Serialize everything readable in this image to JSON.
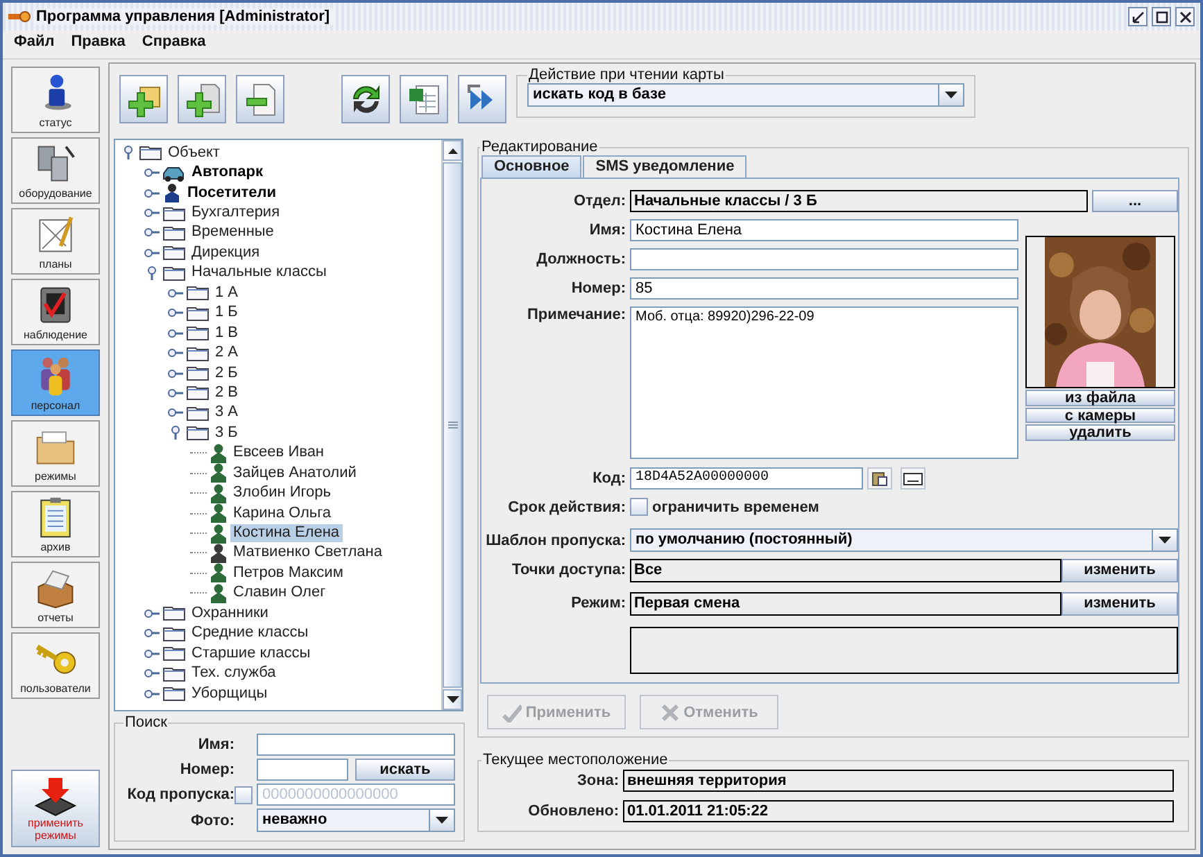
{
  "window": {
    "title": "Программа управления [Administrator]"
  },
  "menu": [
    "Файл",
    "Правка",
    "Справка"
  ],
  "sidebar": {
    "items": [
      {
        "label": "статус",
        "selected": false
      },
      {
        "label": "оборудование",
        "selected": false
      },
      {
        "label": "планы",
        "selected": false
      },
      {
        "label": "наблюдение",
        "selected": false
      },
      {
        "label": "персонал",
        "selected": true
      },
      {
        "label": "режимы",
        "selected": false
      },
      {
        "label": "архив",
        "selected": false
      },
      {
        "label": "отчеты",
        "selected": false
      },
      {
        "label": "пользователи",
        "selected": false
      }
    ],
    "apply_button": "применить режимы"
  },
  "toolbar": {
    "card_action": {
      "legend": "Действие при чтении карты",
      "value": "искать код в базе"
    }
  },
  "tree": [
    {
      "label": "Объект",
      "kind": "folder",
      "expanded": true,
      "selected": false,
      "children": [
        {
          "label": "Автопарк",
          "kind": "car",
          "expanded": false,
          "selected": false
        },
        {
          "label": "Посетители",
          "kind": "visitor",
          "expanded": false,
          "selected": false
        },
        {
          "label": "Бухгалтерия",
          "kind": "folder",
          "expanded": false,
          "selected": false
        },
        {
          "label": "Временные",
          "kind": "folder",
          "expanded": false,
          "selected": false
        },
        {
          "label": "Дирекция",
          "kind": "folder",
          "expanded": false,
          "selected": false
        },
        {
          "label": "Начальные классы",
          "kind": "folder",
          "expanded": true,
          "selected": false,
          "children": [
            {
              "label": "1 А",
              "kind": "folder",
              "expanded": false,
              "selected": false
            },
            {
              "label": "1 Б",
              "kind": "folder",
              "expanded": false,
              "selected": false
            },
            {
              "label": "1 В",
              "kind": "folder",
              "expanded": false,
              "selected": false
            },
            {
              "label": "2 А",
              "kind": "folder",
              "expanded": false,
              "selected": false
            },
            {
              "label": "2 Б",
              "kind": "folder",
              "expanded": false,
              "selected": false
            },
            {
              "label": "2 В",
              "kind": "folder",
              "expanded": false,
              "selected": false
            },
            {
              "label": "3 А",
              "kind": "folder",
              "expanded": false,
              "selected": false
            },
            {
              "label": "3 Б",
              "kind": "folder",
              "expanded": true,
              "selected": false,
              "children": [
                {
                  "label": "Евсеев Иван",
                  "kind": "person",
                  "color": "#2e6b3a",
                  "selected": false
                },
                {
                  "label": "Зайцев Анатолий",
                  "kind": "person",
                  "color": "#2e6b3a",
                  "selected": false
                },
                {
                  "label": "Злобин Игорь",
                  "kind": "person",
                  "color": "#2e6b3a",
                  "selected": false
                },
                {
                  "label": "Карина Ольга",
                  "kind": "person",
                  "color": "#2e6b3a",
                  "selected": false
                },
                {
                  "label": "Костина Елена",
                  "kind": "person",
                  "color": "#2e6b3a",
                  "selected": true
                },
                {
                  "label": "Матвиенко Светлана",
                  "kind": "person",
                  "color": "#3a3a3a",
                  "selected": false
                },
                {
                  "label": "Петров Максим",
                  "kind": "person",
                  "color": "#2e6b3a",
                  "selected": false
                },
                {
                  "label": "Славин Олег",
                  "kind": "person",
                  "color": "#2e6b3a",
                  "selected": false
                }
              ]
            }
          ]
        },
        {
          "label": "Охранники",
          "kind": "folder",
          "expanded": false,
          "selected": false
        },
        {
          "label": "Средние классы",
          "kind": "folder",
          "expanded": false,
          "selected": false
        },
        {
          "label": "Старшие классы",
          "kind": "folder",
          "expanded": false,
          "selected": false
        },
        {
          "label": "Тех. служба",
          "kind": "folder",
          "expanded": false,
          "selected": false
        },
        {
          "label": "Уборщицы",
          "kind": "folder",
          "expanded": false,
          "selected": false
        }
      ]
    }
  ],
  "search": {
    "legend": "Поиск",
    "fields": [
      {
        "label": "Имя:",
        "kind": "text"
      },
      {
        "label": "Номер:",
        "kind": "text_button",
        "button": "искать"
      },
      {
        "label": "Код пропуска:",
        "kind": "checkbox_text",
        "checked": false,
        "placeholder": "0000000000000000"
      },
      {
        "label": "Фото:",
        "kind": "combo",
        "value": "неважно"
      }
    ]
  },
  "editor": {
    "legend": "Редактирование",
    "tabs": [
      {
        "label": "Основное",
        "selected": true
      },
      {
        "label": "SMS уведомление",
        "selected": false
      }
    ],
    "department": {
      "label": "Отдел:",
      "value": "Начальные классы / 3 Б",
      "button": "..."
    },
    "fields": [
      {
        "label": "Имя:",
        "kind": "text",
        "value": "Костина Елена"
      },
      {
        "label": "Должность:",
        "kind": "text"
      },
      {
        "label": "Номер:",
        "kind": "text",
        "value": "85"
      },
      {
        "label": "Примечание:",
        "kind": "textarea",
        "value": "Моб. отца: 89920)296-22-09"
      }
    ],
    "photo": {
      "kind": "picture",
      "buttons": [
        "из файла",
        "с камеры",
        "удалить"
      ]
    },
    "code": {
      "label": "Код:",
      "value": "18D4A52A00000000"
    },
    "validity": {
      "label": "Срок действия:",
      "checkbox": "ограничить временем",
      "checked": false
    },
    "template": {
      "label": "Шаблон пропуска:",
      "value": "по умолчанию (постоянный)"
    },
    "access_points": {
      "label": "Точки доступа:",
      "value": "Все",
      "button": "изменить"
    },
    "mode": {
      "label": "Режим:",
      "value": "Первая смена",
      "button": "изменить"
    },
    "actions": [
      {
        "label": "Применить",
        "kind": "apply",
        "disabled": true
      },
      {
        "label": "Отменить",
        "kind": "cancel",
        "disabled": true
      }
    ]
  },
  "location": {
    "legend": "Текущее местоположение",
    "fields": [
      {
        "label": "Зона:",
        "value": "внешняя территория"
      },
      {
        "label": "Обновлено:",
        "value": "01.01.2011 21:05:22"
      }
    ]
  }
}
